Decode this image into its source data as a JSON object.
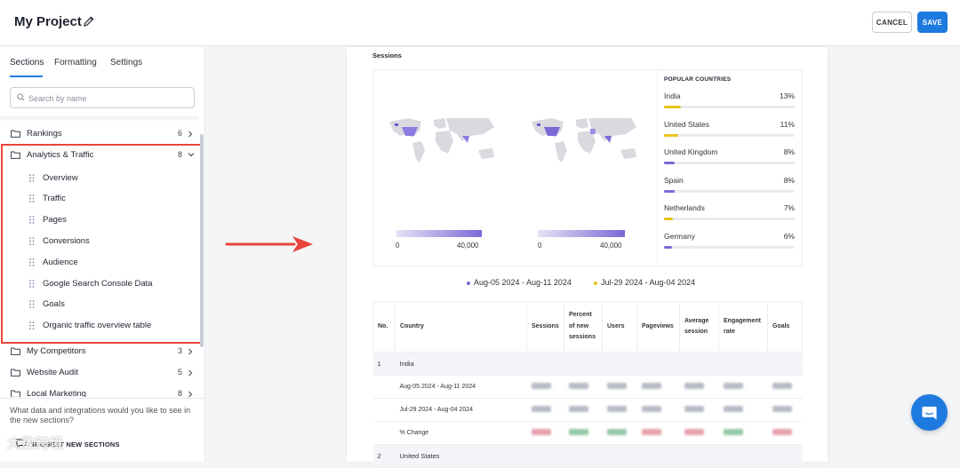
{
  "header": {
    "project_title": "My Project",
    "cancel_label": "CANCEL",
    "save_label": "SAVE"
  },
  "sidebar": {
    "tabs": [
      "Sections",
      "Formatting",
      "Settings"
    ],
    "active_tab": "Sections",
    "search_placeholder": "Search by name",
    "sections": [
      {
        "label": "Rankings",
        "count": "6",
        "expanded": false
      },
      {
        "label": "Analytics & Traffic",
        "count": "8",
        "expanded": true,
        "items": [
          "Overview",
          "Traffic",
          "Pages",
          "Conversions",
          "Audience",
          "Google Search Console Data",
          "Goals",
          "Organic traffic overview table"
        ]
      },
      {
        "label": "My Competitors",
        "count": "3",
        "expanded": false
      },
      {
        "label": "Website Audit",
        "count": "5",
        "expanded": false
      },
      {
        "label": "Local Marketing",
        "count": "8",
        "expanded": false
      }
    ],
    "bottom_question": "What data and integrations would you like to see in the new sections?",
    "suggest_label": "SUGGEST NEW SECTIONS"
  },
  "report": {
    "sessions_title": "Sessions",
    "map_legends": [
      {
        "min": "0",
        "max": "40,000"
      },
      {
        "min": "0",
        "max": "40,000"
      }
    ],
    "popular_countries_title": "POPULAR COUNTRIES",
    "popular_countries": [
      {
        "name": "India",
        "pct": "13%",
        "share": 0.13,
        "color": "#e8c41a"
      },
      {
        "name": "United States",
        "pct": "11%",
        "share": 0.11,
        "color": "#e8c41a"
      },
      {
        "name": "United Kingdom",
        "pct": "8%",
        "share": 0.08,
        "color": "#7a69d6"
      },
      {
        "name": "Spain",
        "pct": "8%",
        "share": 0.08,
        "color": "#7a69d6"
      },
      {
        "name": "Netherlands",
        "pct": "7%",
        "share": 0.07,
        "color": "#e8c41a"
      },
      {
        "name": "Germany",
        "pct": "6%",
        "share": 0.06,
        "color": "#7a69d6"
      }
    ],
    "periods": [
      {
        "label": "Aug-05 2024 - Aug-11 2024",
        "color": "#7a69d6"
      },
      {
        "label": "Jul-29 2024 - Aug-04 2024",
        "color": "#e8c41a"
      }
    ],
    "table": {
      "headers": [
        "No.",
        "Country",
        "Sessions",
        "Percent of new sessions",
        "Users",
        "Pageviews",
        "Average session",
        "Engagement rate",
        "Goals"
      ],
      "rows": [
        {
          "no": "1",
          "country": "India",
          "sub_rows": [
            "Aug-05 2024 - Aug-11 2024",
            "Jul-29 2024 - Aug-04 2024",
            "% Change"
          ]
        },
        {
          "no": "2",
          "country": "United States"
        }
      ]
    }
  },
  "watermark": "大数跨境"
}
